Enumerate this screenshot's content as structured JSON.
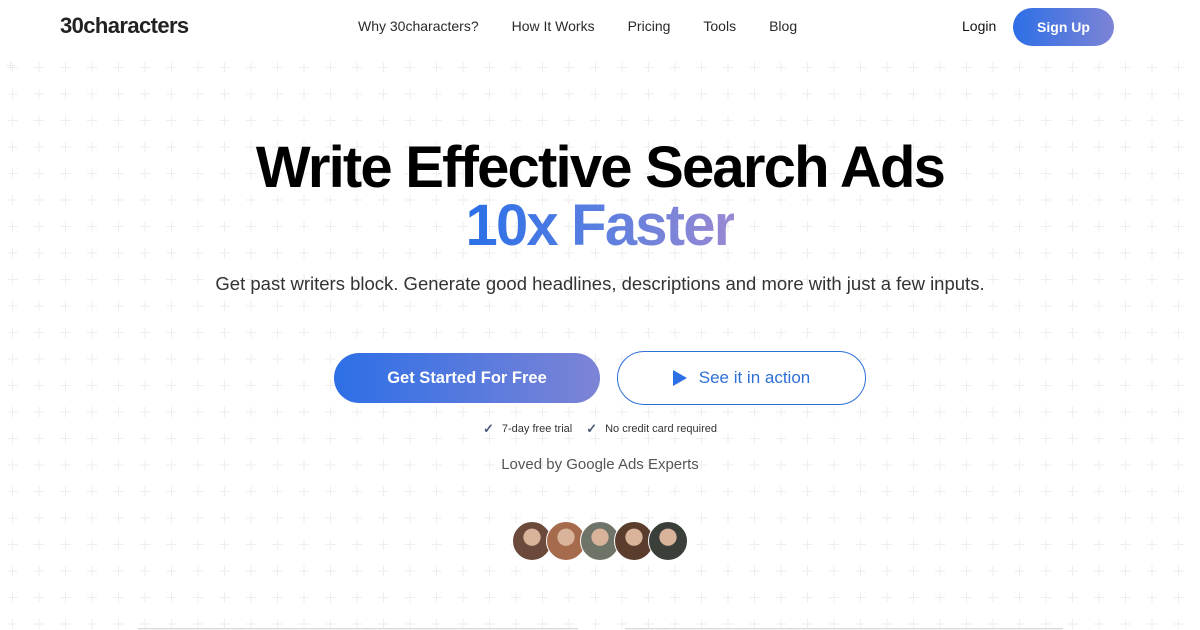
{
  "header": {
    "logo": "30characters",
    "nav": [
      "Why 30characters?",
      "How It Works",
      "Pricing",
      "Tools",
      "Blog"
    ],
    "login": "Login",
    "signup": "Sign Up"
  },
  "hero": {
    "title_line1": "Write Effective Search Ads",
    "title_line2": "10x Faster",
    "subtitle": "Get past writers block. Generate good headlines, descriptions and more with just a few inputs.",
    "cta_primary": "Get Started For Free",
    "cta_secondary": "See it in action",
    "checks": [
      "7-day free trial",
      "No credit card required"
    ],
    "loved": "Loved by Google Ads Experts",
    "avatars": [
      {
        "name": "avatar-1",
        "color": "#6b4a3c"
      },
      {
        "name": "avatar-2",
        "color": "#a66a4c"
      },
      {
        "name": "avatar-3",
        "color": "#6f7468"
      },
      {
        "name": "avatar-4",
        "color": "#5b3d2e"
      },
      {
        "name": "avatar-5",
        "color": "#3a3f3a"
      }
    ]
  },
  "colors": {
    "accent_start": "#2d6fe6",
    "accent_end": "#7d84d6",
    "outline": "#2e6fd8"
  }
}
